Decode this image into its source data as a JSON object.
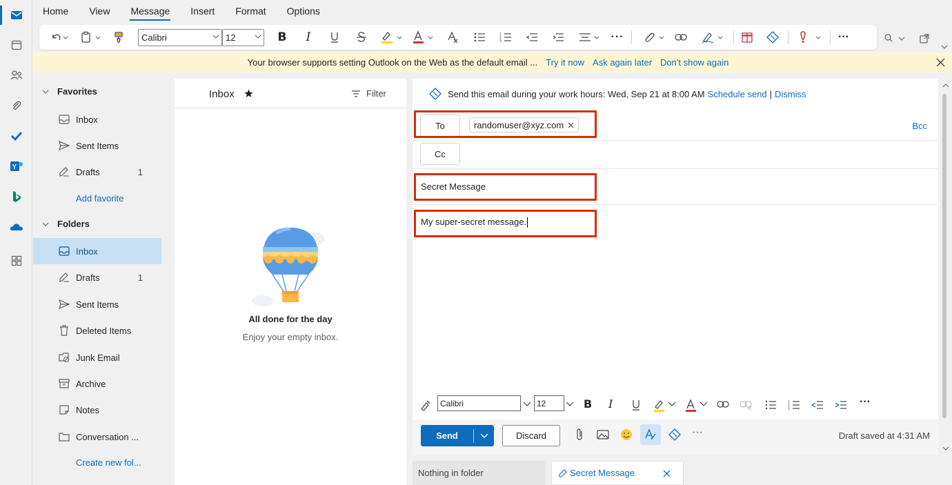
{
  "ribbon": {
    "tabs": [
      "Home",
      "View",
      "Message",
      "Insert",
      "Format",
      "Options"
    ],
    "active_tab": "Message",
    "font_name": "Calibri",
    "font_size": "12"
  },
  "banner": {
    "message": "Your browser supports setting Outlook on the Web as the default email ...",
    "try_it": "Try it now",
    "ask_later": "Ask again later",
    "dont_show": "Don't show again"
  },
  "folders": {
    "favorites_header": "Favorites",
    "favorites": [
      {
        "label": "Inbox",
        "count": ""
      },
      {
        "label": "Sent Items",
        "count": ""
      },
      {
        "label": "Drafts",
        "count": "1"
      }
    ],
    "add_favorite": "Add favorite",
    "folders_header": "Folders",
    "items": [
      {
        "label": "Inbox",
        "count": ""
      },
      {
        "label": "Drafts",
        "count": "1"
      },
      {
        "label": "Sent Items",
        "count": ""
      },
      {
        "label": "Deleted Items",
        "count": ""
      },
      {
        "label": "Junk Email",
        "count": ""
      },
      {
        "label": "Archive",
        "count": ""
      },
      {
        "label": "Notes",
        "count": ""
      },
      {
        "label": "Conversation ...",
        "count": ""
      }
    ],
    "create_new": "Create new fol..."
  },
  "list": {
    "title": "Inbox",
    "filter": "Filter",
    "empty_title": "All done for the day",
    "empty_sub": "Enjoy your empty inbox."
  },
  "compose": {
    "schedule_text": "Send this email during your work hours: Wed, Sep 21 at 8:00 AM",
    "schedule_link": "Schedule send",
    "schedule_sep": "|",
    "dismiss": "Dismiss",
    "to_label": "To",
    "cc_label": "Cc",
    "bcc_label": "Bcc",
    "recipient": "randomuser@xyz.com",
    "subject": "Secret Message",
    "body": "My super-secret message.",
    "font_name": "Calibri",
    "font_size": "12",
    "send": "Send",
    "discard": "Discard",
    "draft_status": "Draft saved at 4:31 AM"
  },
  "bottom_tabs": {
    "left": "Nothing in folder",
    "right": "Secret Message"
  },
  "colors": {
    "accent": "#0f6cbd",
    "selected": "#c7e0f4",
    "banner": "#fdf6d3",
    "highlight_box": "#d92c0a"
  }
}
